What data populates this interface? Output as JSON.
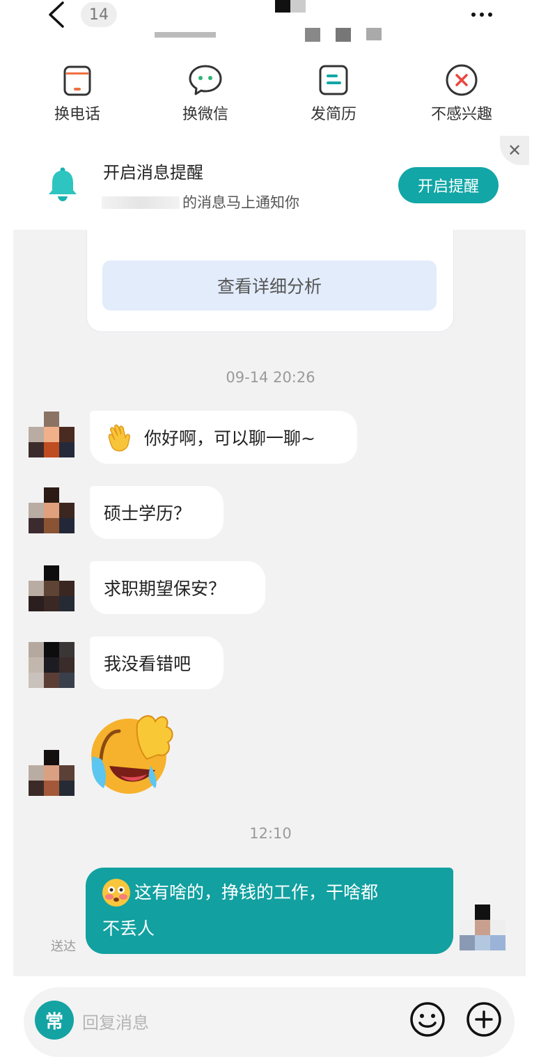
{
  "header": {
    "unread_count": "14",
    "back_icon": "chevron-left-icon",
    "more_icon": "more-horizontal-icon"
  },
  "actions": [
    {
      "label": "换电话",
      "icon": "phone-card-icon"
    },
    {
      "label": "换微信",
      "icon": "wechat-bubble-icon"
    },
    {
      "label": "发简历",
      "icon": "resume-icon"
    },
    {
      "label": "不感兴趣",
      "icon": "not-interested-icon"
    }
  ],
  "notify": {
    "title": "开启消息提醒",
    "subtitle": "的消息马上通知你",
    "button": "开启提醒",
    "close_icon": "close-icon"
  },
  "analysis_card": {
    "button": "查看详细分析"
  },
  "timestamps": [
    "09-14 20:26",
    "12:10"
  ],
  "messages_in": [
    {
      "text": "你好啊，可以聊一聊~",
      "emoji": "waving-hand"
    },
    {
      "text": "硕士学历？"
    },
    {
      "text": "求职期望保安？"
    },
    {
      "text": "我没看错吧"
    },
    {
      "sticker": "laughing-crying-face"
    }
  ],
  "message_out": {
    "line1": "这有啥的，挣钱的工作，干啥都",
    "line2": "不丢人",
    "status": "送达",
    "emoji": "flushed-face"
  },
  "input": {
    "quick_label": "常",
    "placeholder": "回复消息",
    "emoji_icon": "smiley-icon",
    "plus_icon": "plus-circle-icon"
  },
  "colors": {
    "accent": "#12a6a6",
    "chat_bg": "#f2f2f2",
    "bubble_in": "#ffffff",
    "bubble_out": "#12a0a0",
    "analysis_button_bg": "#e3ecfb"
  }
}
